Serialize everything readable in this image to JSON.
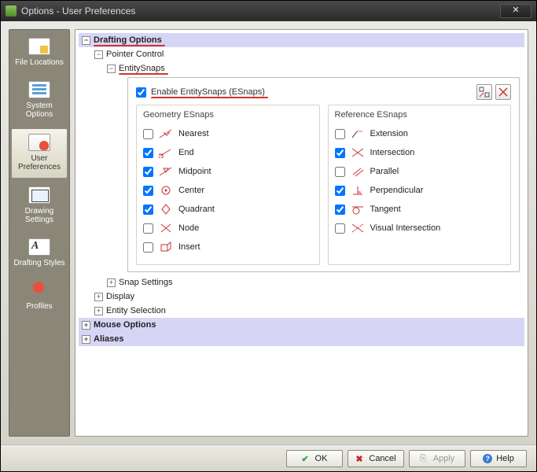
{
  "window": {
    "title": "Options - User Preferences"
  },
  "sidebar": {
    "items": [
      {
        "label": "File Locations"
      },
      {
        "label": "System Options"
      },
      {
        "label": "User Preferences"
      },
      {
        "label": "Drawing Settings"
      },
      {
        "label": "Drafting Styles"
      },
      {
        "label": "Profiles"
      }
    ]
  },
  "tree": {
    "drafting_options": "Drafting Options",
    "pointer_control": "Pointer Control",
    "entity_snaps": "EntitySnaps",
    "snap_settings": "Snap Settings",
    "display": "Display",
    "entity_selection": "Entity Selection",
    "mouse_options": "Mouse Options",
    "aliases": "Aliases"
  },
  "esnap": {
    "enable_label": "Enable EntitySnaps (ESnaps)",
    "enable_checked": true,
    "geometry_title": "Geometry ESnaps",
    "reference_title": "Reference ESnaps",
    "geometry": [
      {
        "label": "Nearest",
        "checked": false
      },
      {
        "label": "End",
        "checked": true
      },
      {
        "label": "Midpoint",
        "checked": true
      },
      {
        "label": "Center",
        "checked": true
      },
      {
        "label": "Quadrant",
        "checked": true
      },
      {
        "label": "Node",
        "checked": false
      },
      {
        "label": "Insert",
        "checked": false
      }
    ],
    "reference": [
      {
        "label": "Extension",
        "checked": false
      },
      {
        "label": "Intersection",
        "checked": true
      },
      {
        "label": "Parallel",
        "checked": false
      },
      {
        "label": "Perpendicular",
        "checked": true
      },
      {
        "label": "Tangent",
        "checked": true
      },
      {
        "label": "Visual Intersection",
        "checked": false
      }
    ]
  },
  "buttons": {
    "ok": "OK",
    "cancel": "Cancel",
    "apply": "Apply",
    "help": "Help"
  }
}
